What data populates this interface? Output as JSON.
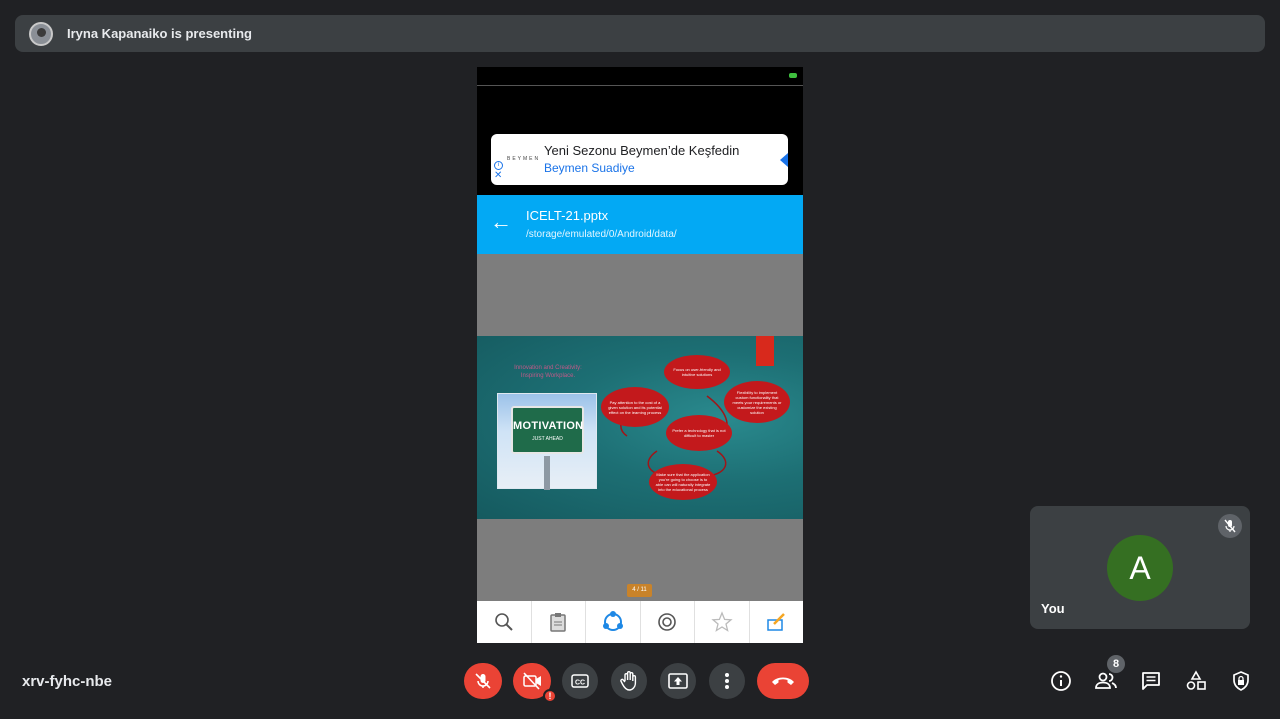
{
  "banner": {
    "presenter_text": "Iryna Kapanaiko is presenting"
  },
  "ad": {
    "brand_logo": "BEYMEN",
    "title": "Yeni Sezonu Beymen’de Keşfedin",
    "subtitle": "Beymen Suadiye",
    "info": "i",
    "close": "✕"
  },
  "file": {
    "name": "ICELT-21.pptx",
    "path": "/storage/emulated/0/Android/data/",
    "back": "←"
  },
  "slide": {
    "title": "Innovation and Creativity: Inspiring Workplace.",
    "sign_big": "MOTIVATION",
    "sign_small": "JUST AHEAD",
    "bubbles": [
      "Focus on user-friendly and intuitive solutions",
      "Pay attention to the cost of a given solution and its potential effect on the learning process",
      "Flexibility to implement custom functionality that meets your requirements or customize the existing solution",
      "Prefer a technology that is not difficult to master",
      "Make sure that the application you're going to choose is to able can will naturally integrate into the educational process"
    ]
  },
  "viewer": {
    "page_indicator": "4 / 11"
  },
  "self": {
    "avatar_letter": "A",
    "label": "You"
  },
  "meeting": {
    "code": "xrv-fyhc-nbe",
    "warning_badge": "!"
  },
  "people": {
    "count": "8"
  }
}
